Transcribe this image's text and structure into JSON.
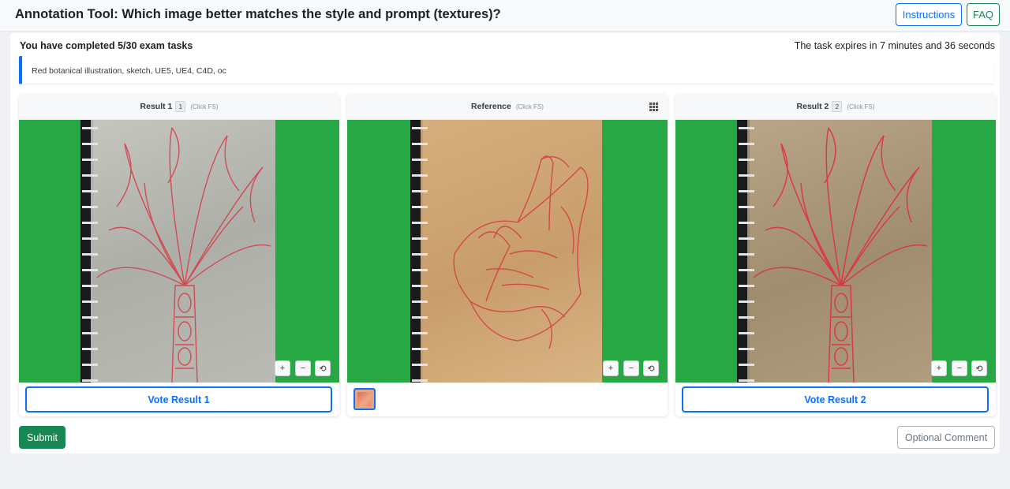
{
  "header": {
    "title": "Annotation Tool: Which image better matches the style and prompt (textures)?",
    "instructions_label": "Instructions",
    "faq_label": "FAQ"
  },
  "status": {
    "completed_text": "You have completed 5/30 exam tasks",
    "expires_text": "The task expires in 7 minutes and 36 seconds"
  },
  "prompt": {
    "text": "Red botanical illustration, sketch, UE5, UE4, C4D, oc"
  },
  "panels": [
    {
      "title": "Result 1",
      "badge": "1",
      "hint": "(Click FS)",
      "vote_label": "Vote Result 1"
    },
    {
      "title": "Reference",
      "hint": "(Click FS)"
    },
    {
      "title": "Result 2",
      "badge": "2",
      "hint": "(Click FS)",
      "vote_label": "Vote Result 2"
    }
  ],
  "controls": {
    "zoom_in": "+",
    "zoom_out": "−",
    "reset": "⟲"
  },
  "footer": {
    "submit_label": "Submit",
    "comment_label": "Optional Comment"
  },
  "colors": {
    "accent": "#0d6efd",
    "success": "#198754",
    "image_background": "#28a745",
    "sketch_ink": "#d63a45"
  },
  "icons": {
    "grid": "grid-icon",
    "zoom_in": "plus-icon",
    "zoom_out": "minus-icon",
    "reset": "reset-icon"
  }
}
